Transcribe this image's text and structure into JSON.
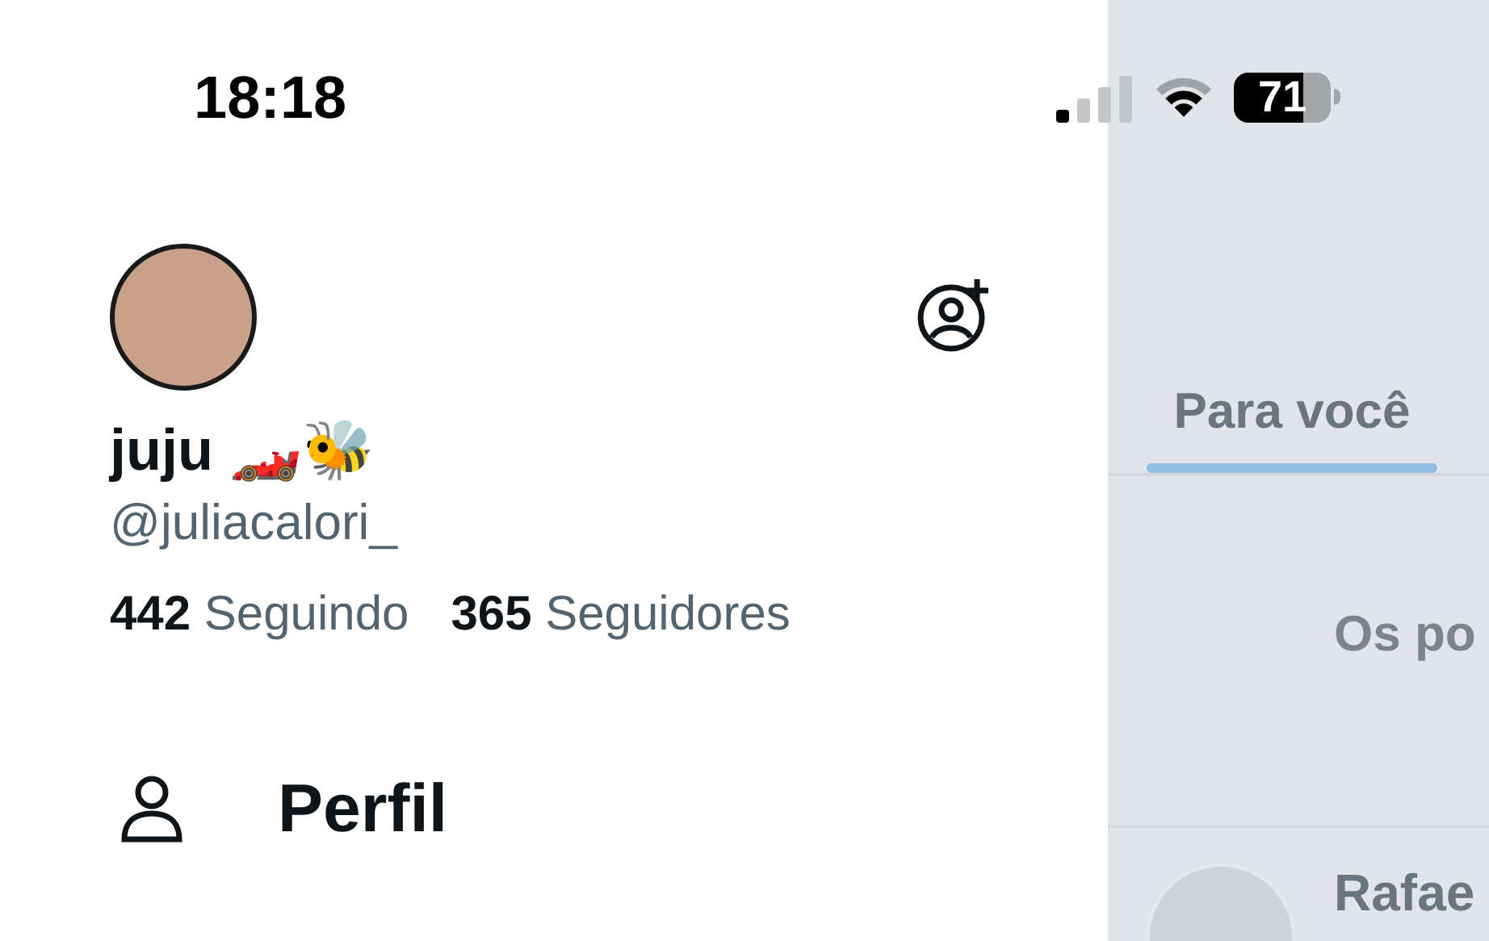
{
  "status_bar": {
    "time": "18:18",
    "battery_text": "71",
    "level": 0.71
  },
  "drawer": {
    "display_name": "juju 🏎️🐝",
    "handle": "@juliacalori_",
    "stats": [
      {
        "count": "442",
        "label": "Seguindo"
      },
      {
        "count": "365",
        "label": "Seguidores"
      }
    ],
    "menu": [
      {
        "label": "Perfil"
      }
    ]
  },
  "timeline": {
    "tabs": [
      {
        "label": "Para você",
        "selected": true
      }
    ],
    "message": "Os po",
    "post_author": "Rafae"
  }
}
